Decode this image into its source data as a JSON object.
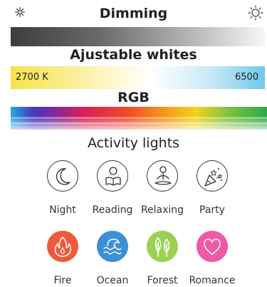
{
  "sections": {
    "dimming_title": "Dimming",
    "whites_title": "Ajustable whites",
    "rgb_title": "RGB",
    "activity_title": "Activity lights"
  },
  "whites": {
    "min_label": "2700 K",
    "max_label": "6500"
  },
  "icons": {
    "dim_low": "sun-small-icon",
    "dim_high": "sun-large-icon"
  },
  "activities_row1": [
    {
      "label": "Night",
      "icon": "moon-icon"
    },
    {
      "label": "Reading",
      "icon": "reading-person-icon"
    },
    {
      "label": "Relaxing",
      "icon": "meditation-icon"
    },
    {
      "label": "Party",
      "icon": "party-popper-icon"
    }
  ],
  "activities_row2": [
    {
      "label": "Fire",
      "icon": "flame-icon",
      "color": "#ee5a3d"
    },
    {
      "label": "Ocean",
      "icon": "waves-icon",
      "color": "#3b8fd6"
    },
    {
      "label": "Forest",
      "icon": "trees-icon",
      "color": "#9cd052"
    },
    {
      "label": "Romance",
      "icon": "heart-icon",
      "color": "#ee5aa6"
    }
  ]
}
